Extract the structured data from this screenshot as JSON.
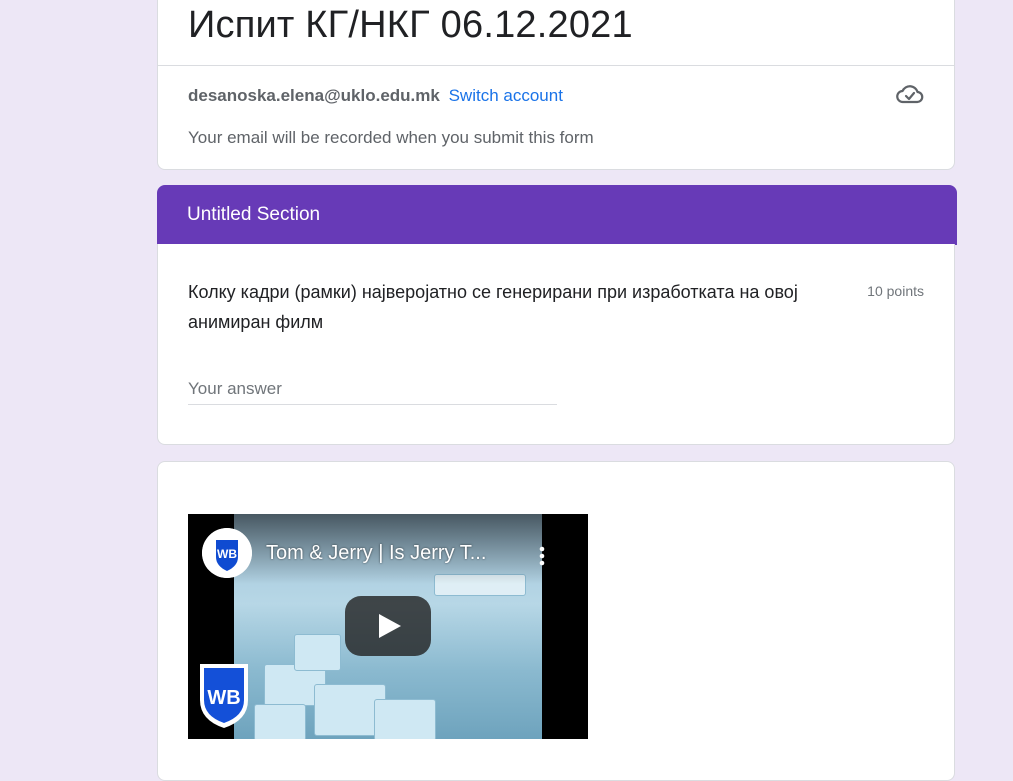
{
  "form": {
    "title": "Испит КГ/НКГ 06.12.2021",
    "account_email": "desanoska.elena@uklo.edu.mk",
    "switch_account": "Switch account",
    "record_note": "Your email will be recorded when you submit this form"
  },
  "section": {
    "title": "Untitled Section",
    "color": "#673ab7"
  },
  "question": {
    "text": "Колку кадри (рамки) најверојатно се генерирани при изработката на овој анимиран филм",
    "points": "10 points",
    "answer_placeholder": "Your answer"
  },
  "video": {
    "title": "Tom & Jerry | Is Jerry T...",
    "channel_logo_text": "WB",
    "icons": [
      "cloud-check-icon",
      "more-vert-icon",
      "play-icon",
      "wb-logo"
    ]
  }
}
